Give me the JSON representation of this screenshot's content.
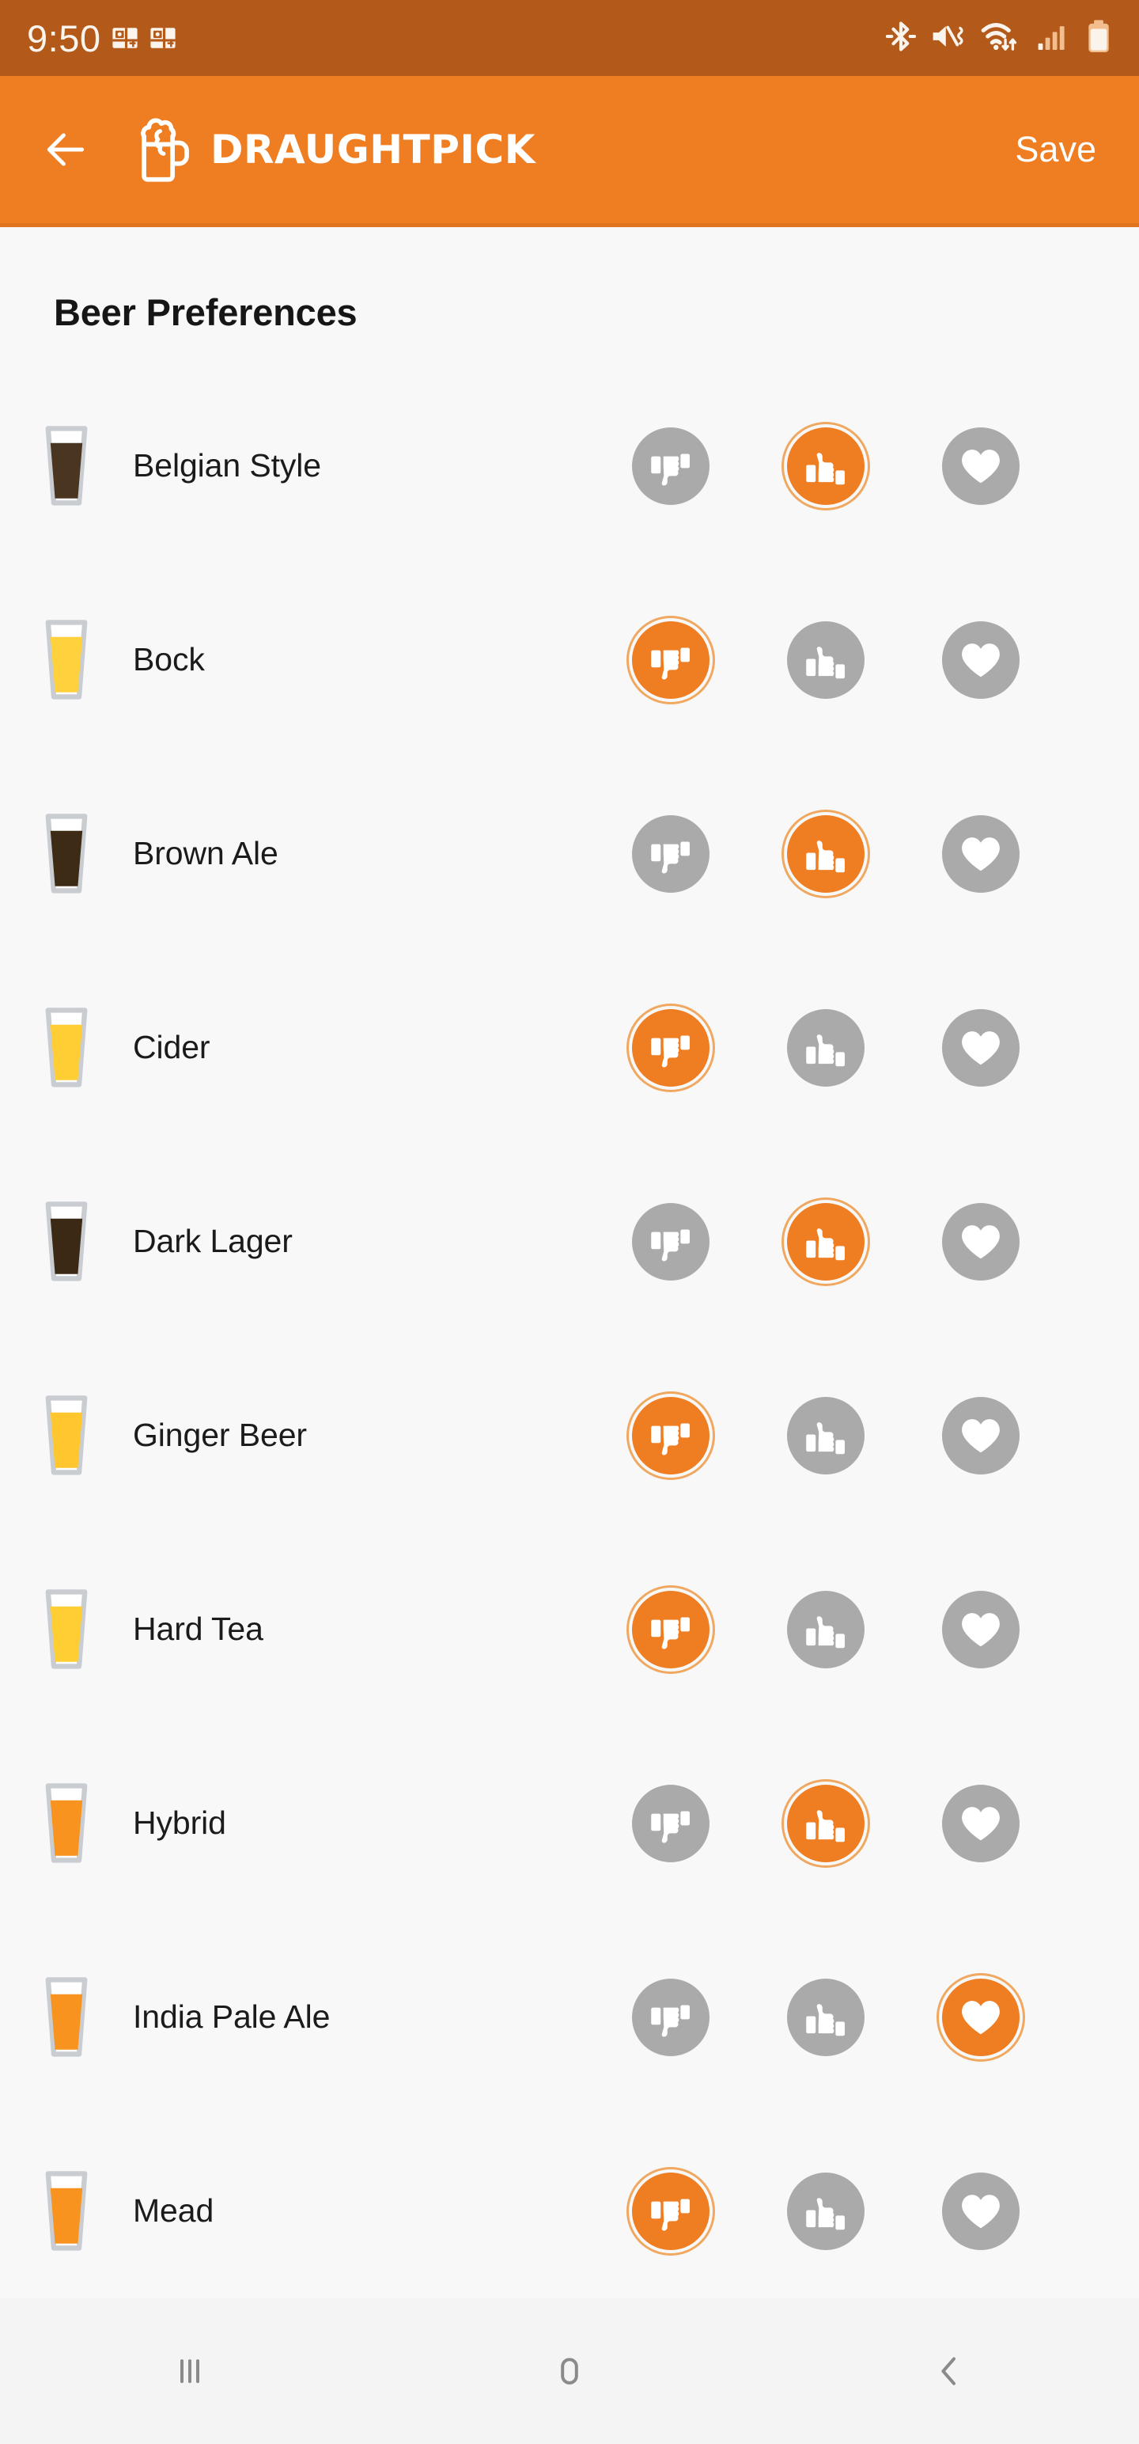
{
  "status_bar": {
    "time": "9:50",
    "bg_color": "#B3591A",
    "icons_left": [
      "calculator-app-icon",
      "calculator-app-icon"
    ],
    "icons_right": [
      "bluetooth-icon",
      "volume-mute-vibrate-icon",
      "wifi-data-transfer-icon",
      "cellular-signal-icon",
      "battery-icon"
    ]
  },
  "app_bar": {
    "back_icon": "arrow-left-icon",
    "logo_icon": "beer-mug-icon",
    "brand_primary": "DRAUGHT",
    "brand_secondary": "PICK",
    "save_label": "Save",
    "bg_color": "#EF7D21",
    "text_color": "#FFFFFF"
  },
  "main": {
    "section_title": "Beer Preferences",
    "bg_color": "#F8F8F8",
    "accent_color": "#EF7D21",
    "inactive_color": "#AAAAAA",
    "rating_options": [
      "dislike",
      "like",
      "love"
    ],
    "rating_icons": [
      "thumbs-down-icon",
      "thumbs-up-icon",
      "heart-icon"
    ],
    "rows": [
      {
        "name": "Belgian Style",
        "glass_color": "#4A3520",
        "rating": "like"
      },
      {
        "name": "Bock",
        "glass_color": "#FFD13D",
        "rating": "dislike"
      },
      {
        "name": "Brown Ale",
        "glass_color": "#3E2B16",
        "rating": "like"
      },
      {
        "name": "Cider",
        "glass_color": "#FFCE35",
        "rating": "dislike"
      },
      {
        "name": "Dark Lager",
        "glass_color": "#3B2815",
        "rating": "like"
      },
      {
        "name": "Ginger Beer",
        "glass_color": "#FFC62E",
        "rating": "dislike"
      },
      {
        "name": "Hard Tea",
        "glass_color": "#FFCE32",
        "rating": "dislike"
      },
      {
        "name": "Hybrid",
        "glass_color": "#F7931E",
        "rating": "like"
      },
      {
        "name": "India Pale Ale",
        "glass_color": "#F7931E",
        "rating": "love"
      },
      {
        "name": "Mead",
        "glass_color": "#F7931E",
        "rating": "dislike"
      }
    ]
  },
  "nav_bar": {
    "bg_color": "#F4F4F4",
    "buttons": [
      "recents-icon",
      "home-icon",
      "back-icon"
    ]
  }
}
